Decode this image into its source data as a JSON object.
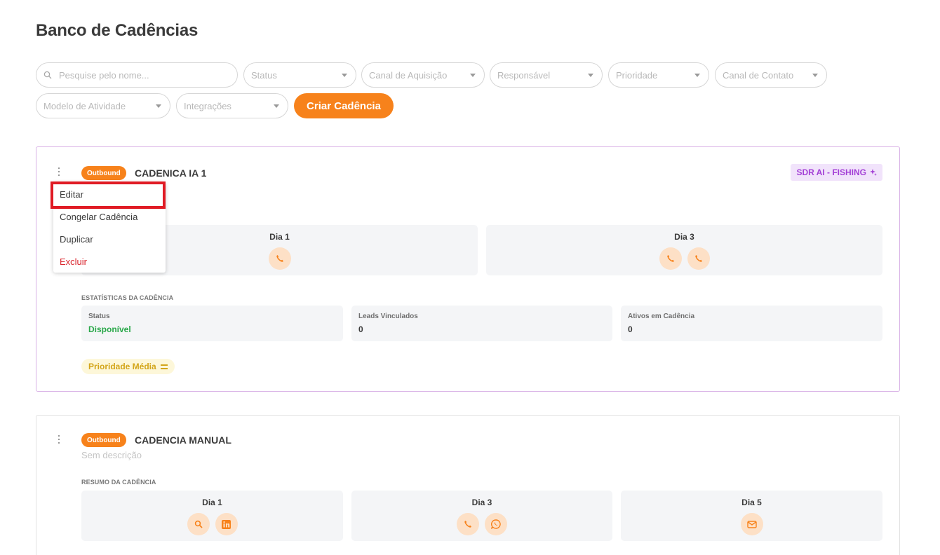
{
  "page": {
    "title": "Banco de Cadências"
  },
  "filters": {
    "search_placeholder": "Pesquise pelo nome...",
    "status": "Status",
    "canal_aquisicao": "Canal de Aquisição",
    "responsavel": "Responsável",
    "prioridade": "Prioridade",
    "canal_contato": "Canal de Contato",
    "modelo_atividade": "Modelo de Atividade",
    "integracoes": "Integrações"
  },
  "actions": {
    "create_label": "Criar Cadência"
  },
  "colors": {
    "accent": "#f7821b",
    "ai_badge": "#a33fd6",
    "status_green": "#2aa84a",
    "danger": "#d9252d",
    "priority": "#d3a51a"
  },
  "cards": [
    {
      "badge": "Outbound",
      "title": "CADENICA IA 1",
      "ai_badge": "SDR AI - FISHING",
      "days": [
        {
          "label": "Dia 1",
          "icons": [
            "phone-icon"
          ]
        },
        {
          "label": "Dia 3",
          "icons": [
            "phone-icon",
            "phone-icon"
          ]
        }
      ],
      "stats_title": "ESTATÍSTICAS DA CADÊNCIA",
      "stats": [
        {
          "label": "Status",
          "value": "Disponível"
        },
        {
          "label": "Leads Vinculados",
          "value": "0"
        },
        {
          "label": "Ativos em Cadência",
          "value": "0"
        }
      ],
      "priority": "Prioridade Média"
    },
    {
      "badge": "Outbound",
      "title": "CADENCIA MANUAL",
      "description": "Sem descrição",
      "summary_title": "RESUMO DA CADÊNCIA",
      "days": [
        {
          "label": "Dia 1",
          "icons": [
            "search-icon",
            "linkedin-icon"
          ]
        },
        {
          "label": "Dia 3",
          "icons": [
            "phone-icon",
            "whatsapp-icon"
          ]
        },
        {
          "label": "Dia 5",
          "icons": [
            "email-icon"
          ]
        }
      ]
    }
  ],
  "context_menu": {
    "items": [
      "Editar",
      "Congelar Cadência",
      "Duplicar",
      "Excluir"
    ]
  }
}
